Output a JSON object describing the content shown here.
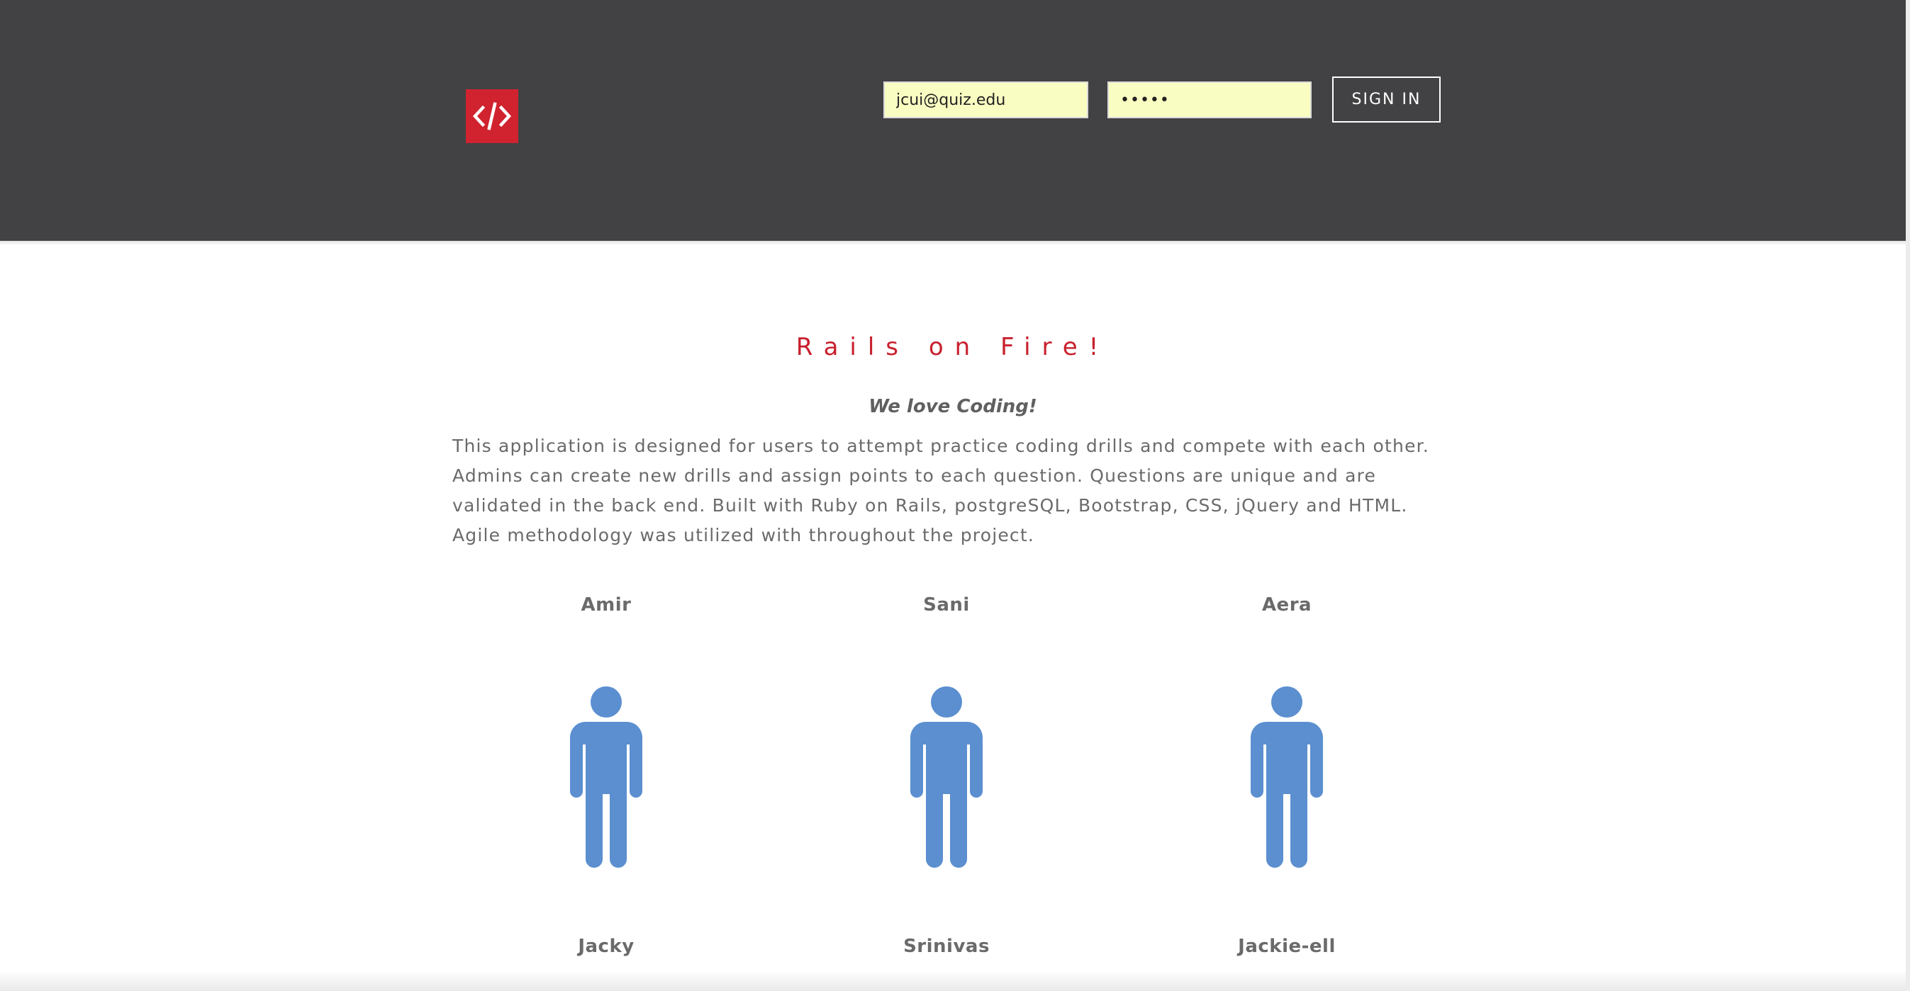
{
  "colors": {
    "navbar_bg": "#424244",
    "logo_bg": "#d0232f",
    "title": "#c8202d",
    "input_bg": "#fafdc2",
    "avatar": "#5b8fd0",
    "text": "#6a6a6a"
  },
  "header": {
    "logo_icon": "code-brackets-icon",
    "login": {
      "email_value": "jcui@quiz.edu",
      "password_value": "•••••",
      "signin_label": "SIGN IN"
    }
  },
  "main": {
    "title": "Rails on Fire!",
    "tagline": "We love Coding!",
    "description": "This application is designed for users to attempt practice coding drills and compete with each other. Admins can create new drills and assign points to each question. Questions are unique and are validated in the back end. Built with Ruby on Rails, postgreSQL, Bootstrap, CSS, jQuery and HTML. Agile methodology was utilized with throughout the project."
  },
  "team": {
    "avatar_icon": "person-icon",
    "members": [
      {
        "name": "Amir"
      },
      {
        "name": "Sani"
      },
      {
        "name": "Aera"
      },
      {
        "name": "Jacky"
      },
      {
        "name": "Srinivas"
      },
      {
        "name": "Jackie-ell"
      }
    ]
  }
}
